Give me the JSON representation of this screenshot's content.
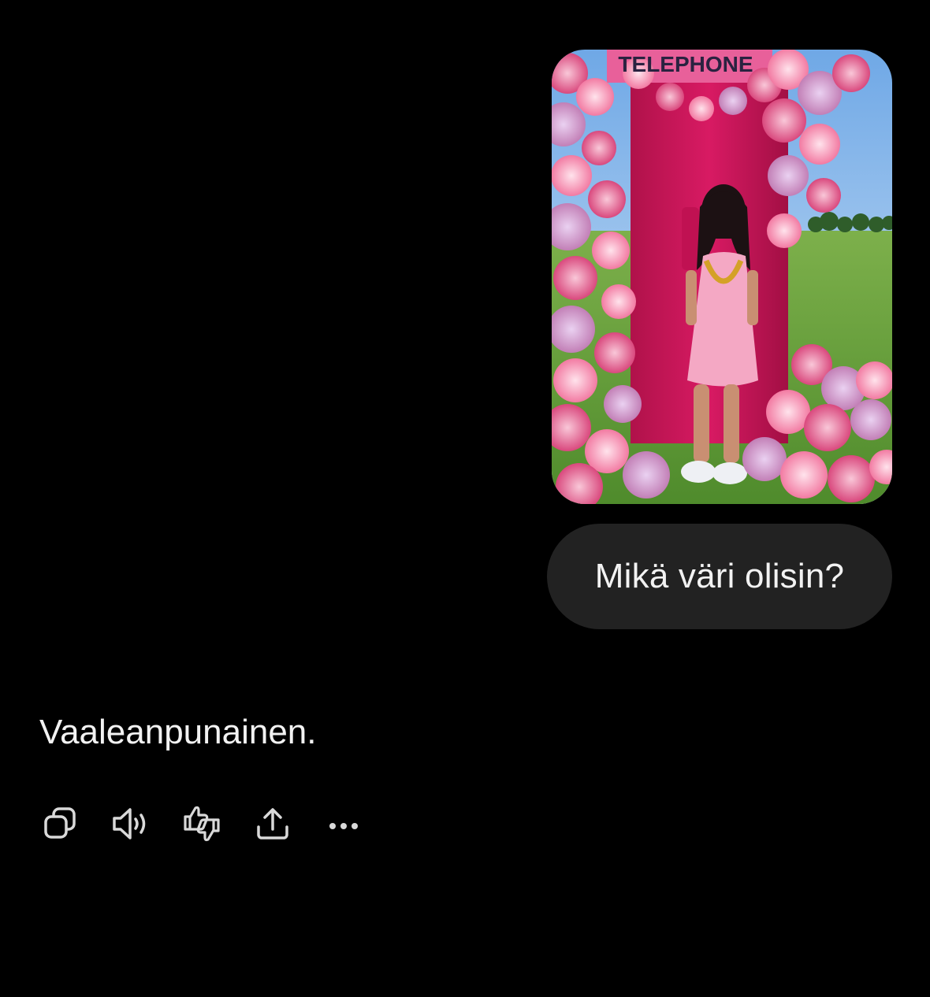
{
  "conversation": {
    "user_message": {
      "image": {
        "description_icon": "photo-attachment",
        "sign_text": "TELEPHONE"
      },
      "text": "Mikä väri olisin?"
    },
    "assistant_message": {
      "text": "Vaaleanpunainen."
    }
  },
  "actions": [
    {
      "name": "copy",
      "icon": "copy-icon"
    },
    {
      "name": "read-aloud",
      "icon": "speaker-icon"
    },
    {
      "name": "feedback",
      "icon": "thumbs-up-down-icon"
    },
    {
      "name": "share",
      "icon": "share-icon"
    },
    {
      "name": "more",
      "icon": "more-icon"
    }
  ],
  "colors": {
    "background": "#000000",
    "bubble": "#222222",
    "text": "#f2f2f2",
    "icon": "#d9d9d9"
  }
}
